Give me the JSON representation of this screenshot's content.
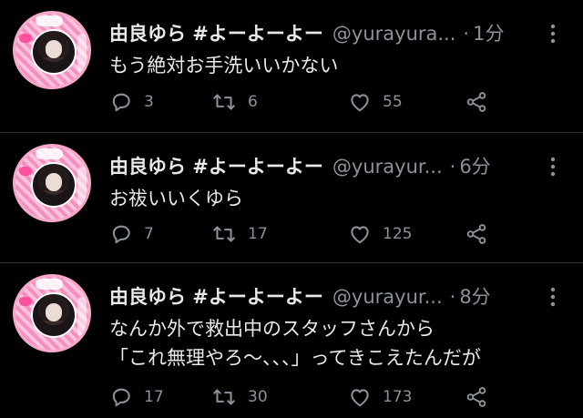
{
  "tweets": [
    {
      "display_name": "由良ゆら #よーよーよー",
      "handle": "@yurayura...",
      "separator": "·",
      "time": "1分",
      "lines": [
        "もう絶対お手洗いいかない"
      ],
      "replies": "3",
      "retweets": "6",
      "likes": "55"
    },
    {
      "display_name": "由良ゆら #よーよーよー",
      "handle": "@yurayur...",
      "separator": "·",
      "time": "6分",
      "lines": [
        "お祓いいくゆら"
      ],
      "replies": "7",
      "retweets": "17",
      "likes": "125"
    },
    {
      "display_name": "由良ゆら #よーよーよー",
      "handle": "@yurayur...",
      "separator": "·",
      "time": "8分",
      "lines": [
        "なんか外で救出中のスタッフさんから",
        "「これ無理やろ〜、、、」ってきこえたんだが"
      ],
      "replies": "17",
      "retweets": "30",
      "likes": "173"
    }
  ],
  "icons": {
    "reply": "reply-icon",
    "retweet": "retweet-icon",
    "like": "heart-icon",
    "share": "share-icon",
    "more": "more-vertical-icon"
  },
  "colors": {
    "background": "#000000",
    "text": "#e7e9ea",
    "secondary_text": "#8b9299",
    "divider": "#2f3336"
  }
}
